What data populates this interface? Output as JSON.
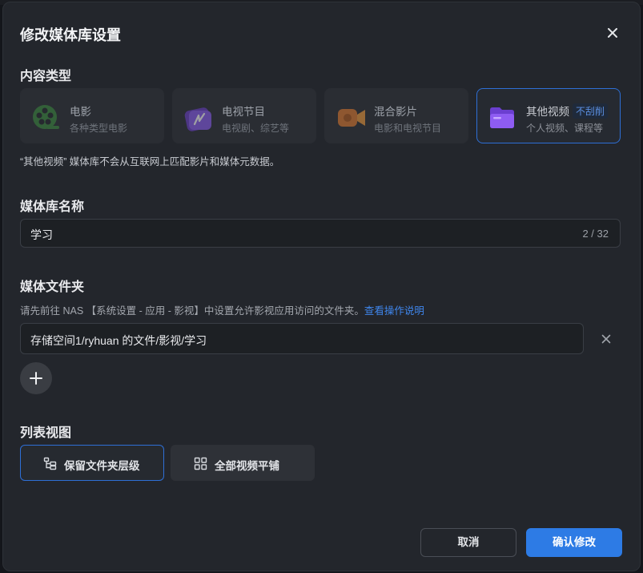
{
  "dialog": {
    "title": "修改媒体库设置"
  },
  "content_type": {
    "label": "内容类型",
    "cards": [
      {
        "name": "电影",
        "desc": "各种类型电影",
        "icon": "film-reel-icon",
        "selected": false
      },
      {
        "name": "电视节目",
        "desc": "电视剧、综艺等",
        "icon": "tv-show-icon",
        "selected": false
      },
      {
        "name": "混合影片",
        "desc": "电影和电视节目",
        "icon": "video-camera-icon",
        "selected": false
      },
      {
        "name": "其他视频",
        "badge": "不刮削",
        "desc": "个人视频、课程等",
        "icon": "folder-video-icon",
        "selected": true
      }
    ],
    "note": "“其他视频” 媒体库不会从互联网上匹配影片和媒体元数据。"
  },
  "library_name": {
    "label": "媒体库名称",
    "value": "学习",
    "count": "2 / 32"
  },
  "media_folder": {
    "label": "媒体文件夹",
    "hint": "请先前往 NAS 【系统设置 - 应用 - 影视】中设置允许影视应用访问的文件夹。",
    "hint_link": "查看操作说明",
    "folders": [
      "存储空间1/ryhuan 的文件/影视/学习"
    ]
  },
  "list_view": {
    "label": "列表视图",
    "options": [
      {
        "label": "保留文件夹层级",
        "icon": "folder-tree-icon",
        "selected": true
      },
      {
        "label": "全部视频平铺",
        "icon": "grid-icon",
        "selected": false
      }
    ]
  },
  "actions": {
    "cancel": "取消",
    "confirm": "确认修改"
  },
  "colors": {
    "accent": "#2d7be5",
    "dialog_bg": "#23262c",
    "link": "#3f86ec"
  }
}
